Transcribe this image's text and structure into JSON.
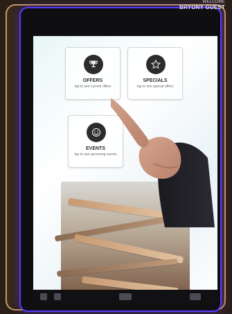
{
  "kiosk": {
    "welcome": {
      "line1": "WELCOME",
      "line2": "BRYONY GUEST"
    },
    "tiles": [
      {
        "label": "OFFERS",
        "subtitle": "tap to see current offers",
        "icon": "trophy-icon"
      },
      {
        "label": "SPECIALS",
        "subtitle": "tap to see special offers",
        "icon": "star-icon"
      },
      {
        "label": "EVENTS",
        "subtitle": "tap to see upcoming events",
        "icon": "smiley-icon"
      }
    ],
    "bottom_bar": {
      "icons": [
        "menu-icon",
        "grid-icon",
        "home-icon",
        "back-icon"
      ]
    }
  }
}
